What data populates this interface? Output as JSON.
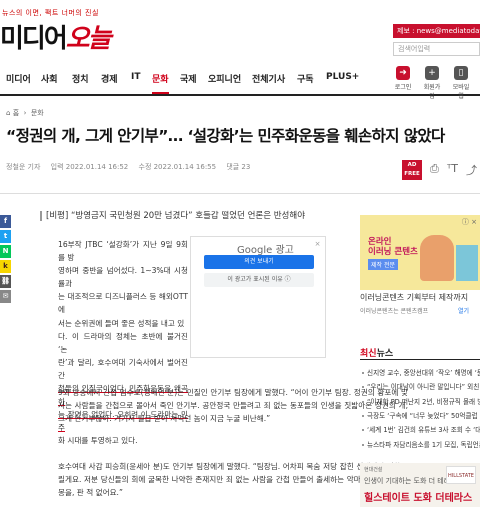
{
  "brand": {
    "tagline": "뉴스의 이면, 팩트 너머의 진실",
    "name_part1": "미디어",
    "name_part2": "오늘"
  },
  "header": {
    "tip_box": "제보 : news@mediatoday.co.kr",
    "search_placeholder": "검색어입력"
  },
  "nav": {
    "items": [
      "미디어",
      "사회",
      "정치",
      "경제",
      "IT",
      "문화",
      "국제",
      "오피니언",
      "전체기사",
      "구독",
      "PLUS+"
    ],
    "active_index": 5,
    "icons": [
      {
        "label": "로그인",
        "icon": "login-icon",
        "color": "#c8102e"
      },
      {
        "label": "회원가입",
        "icon": "user-add-icon",
        "color": "#555555"
      },
      {
        "label": "모바일웹",
        "icon": "mobile-icon",
        "color": "#555555"
      }
    ]
  },
  "breadcrumb": {
    "home": "홈",
    "section": "문화"
  },
  "article": {
    "title": "“정권의 개, 그게 안기부”… ‘설강화’는 민주화운동을 훼손하지 않았다",
    "author": "정철운 기자",
    "published": "입력 2022.01.14 16:52",
    "modified": "수정 2022.01.14 16:55",
    "comments": "댓글 23",
    "adfree": "AD FREE",
    "subhead": "[비평] “방영금지 국민청원 20만 넘겼다” 호들갑 떨었던 언론은 반성해야",
    "lead_lines": [
      "16부작 JTBC ‘설강화’가 지난 9일 9회를 방",
      "영하며 중반을 넘어섰다. 1~3%대 시청률과",
      "는 대조적으로 디즈니플러스 등 해외OTT에",
      "서는 순위권에 들며 좋은 성적을 내고 있",
      "다. 이 드라마의 정체는 초반에 불거진 ‘논",
      "란’과 달리, 호수여대 기숙사에서 벌어진 간",
      "첩들의 인질극이었다. 민주화운동을 왜곡하",
      "는 장면은 없었다. 오히려 이 드라마는 민주",
      "화 시대를 투영하고 있다."
    ],
    "para2": "9회 방송에서 간첩 임수호(정해인 분)는 민질인 안기부 팀장에게 말했다. “어이 안기부 팀장. 정권의 황포에 맞서는 사람들을 간첩으로 몰아서 죽인 안기부. 공안정국 만들려고 죄 없는 동포들의 인생을 짓밟아온 정권의 개, 그게 안기부잖아. 거기서 월급 받아 처먹던 놈이 지금 누굴 비난해.”",
    "para3": "호수여대 사감 피승희(윤세아 분)도 안기부 팀장에게 말했다. “팀장님. 어차피 목숨 저당 잡힌 신세니까 말씀드릴게요. 저분 당신들의 회에 굴복한 나약한 존재지만 죄 없는 사람을 간첩 만들어 출세하는 악마들한테 우린 악몽을, 판 적 없어요.”"
  },
  "google_ad": {
    "brand": "Google 광고",
    "btn_primary": "의견 보내기",
    "btn_secondary": "이 광고가 표시된 이유 ⓘ",
    "close": "×"
  },
  "side_ad": {
    "title_line1": "온라인",
    "title_line2": "이러닝 콘텐츠",
    "badge": "제작 전문",
    "line1": "이러닝콘텐츠 기획부터 제작까지",
    "line2": "이러닝콘텐츠는 콘텐츠캠프",
    "open": "열기",
    "close": "ⓘ ×"
  },
  "latest": {
    "heading_red": "최신",
    "heading_dark": "뉴스",
    "items": [
      "신지영 교수, 중앙선대위 ‘작오’ 해명에 ‘문제',",
      "“우리는 이대남이 아니란 말입니다” 외친 조",
      "“이재학 PD 떠난지 2년, 비정규직 몰래 방관",
      "극장도 ‘구속에 “너무 늦었다” 50억클럽 대",
      "‘세계 1번’ 김건희 유튜브 3사 조회 수 ‘대선'",
      "뉴스타파 자담리음소를 1기 모집, 독립언론"
    ]
  },
  "bottom_ad": {
    "header": "현대건설",
    "text": "인생이 기대하는 도화 더 테라스",
    "big": "힐스테이트 도화 더테라스",
    "logo": "HILLSTATE"
  },
  "share_colors": [
    "#3b5998",
    "#1da1f2",
    "#03c75a",
    "#f7d600",
    "#555555",
    "#888888"
  ],
  "colors": {
    "accent": "#d0021b",
    "tip_box": "#c8102e"
  }
}
